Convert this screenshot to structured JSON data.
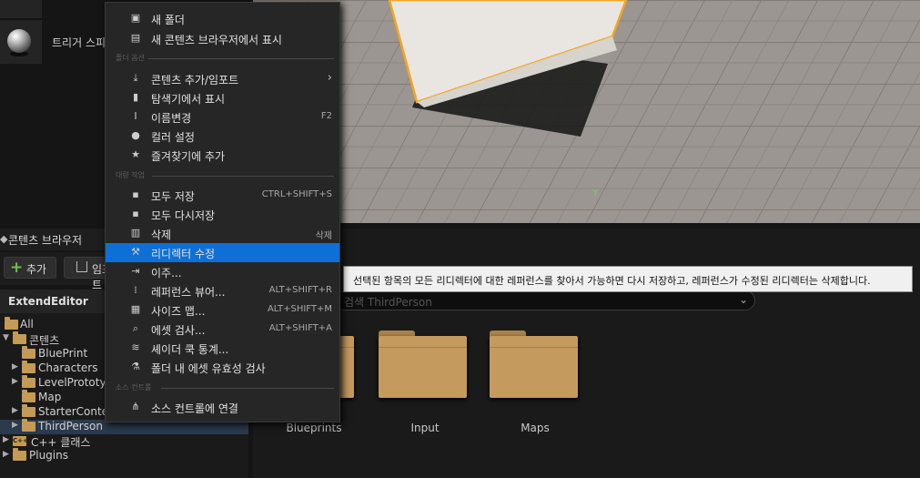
{
  "place_actors": {
    "items": [
      {
        "label": ""
      },
      {
        "label": "트리거 스피어"
      }
    ]
  },
  "viewport": {
    "axis_label": "Y"
  },
  "content_browser": {
    "tab_label": "콘텐츠 브라우저",
    "add_label": "추가",
    "import_label": "임포트",
    "tree_header": "ExtendEditor",
    "tree": [
      {
        "label": "All"
      },
      {
        "label": "콘텐츠"
      },
      {
        "label": "BluePrint"
      },
      {
        "label": "Characters"
      },
      {
        "label": "LevelPrototyping"
      },
      {
        "label": "Map"
      },
      {
        "label": "StarterContent"
      },
      {
        "label": "ThirdPerson"
      },
      {
        "label": "C++ 클래스"
      },
      {
        "label": "Plugins"
      }
    ],
    "search_placeholder": "검색 ThirdPerson",
    "folders": [
      {
        "label": "Blueprints"
      },
      {
        "label": "Input"
      },
      {
        "label": "Maps"
      }
    ]
  },
  "context_menu": {
    "items": [
      {
        "label": "새 폴더",
        "shortcut": "",
        "icon": "new-folder-icon"
      },
      {
        "label": "새 콘텐츠 브라우저에서 표시",
        "shortcut": "",
        "icon": "browse-icon"
      },
      {
        "label": "콘텐츠 추가/임포트",
        "shortcut": "",
        "icon": "import-icon"
      },
      {
        "label": "탐색기에서 표시",
        "shortcut": "",
        "icon": "explorer-icon"
      },
      {
        "label": "이름변경",
        "shortcut": "F2",
        "icon": "rename-icon"
      },
      {
        "label": "컬러 설정",
        "shortcut": "",
        "icon": "color-icon"
      },
      {
        "label": "즐겨찾기에 추가",
        "shortcut": "",
        "icon": "star-icon"
      },
      {
        "label": "모두 저장",
        "shortcut": "CTRL+SHIFT+S",
        "icon": "save-icon"
      },
      {
        "label": "모두 다시저장",
        "shortcut": "",
        "icon": "resave-icon"
      },
      {
        "label": "삭제",
        "shortcut": "삭제",
        "icon": "trash-icon"
      },
      {
        "label": "리디렉터 수정",
        "shortcut": "",
        "icon": "wrench-icon"
      },
      {
        "label": "이주...",
        "shortcut": "",
        "icon": "migrate-icon"
      },
      {
        "label": "레퍼런스 뷰어...",
        "shortcut": "ALT+SHIFT+R",
        "icon": "reference-icon"
      },
      {
        "label": "사이즈 맵...",
        "shortcut": "ALT+SHIFT+M",
        "icon": "sizemap-icon"
      },
      {
        "label": "에셋 검사...",
        "shortcut": "ALT+SHIFT+A",
        "icon": "audit-icon"
      },
      {
        "label": "셰이더 쿡 통계...",
        "shortcut": "",
        "icon": "shader-icon"
      },
      {
        "label": "폴더 내 에셋 유효성 검사",
        "shortcut": "",
        "icon": "flask-icon"
      },
      {
        "label": "소스 컨트롤에 연결",
        "shortcut": "",
        "icon": "source-control-icon"
      }
    ],
    "sections": [
      {
        "label": "폴더 옵션"
      },
      {
        "label": "대량 작업"
      },
      {
        "label": "소스 컨트롤"
      }
    ]
  },
  "tooltip": {
    "text": "선택된 항목의 모든 리디렉터에 대한 레퍼런스를 찾아서 가능하면 다시 저장하고, 레퍼런스가 수정된 리디렉터는 삭제합니다."
  },
  "colors": {
    "highlight": "#0e70d6",
    "folder": "#c49a5e",
    "selection_outline": "#f5a623"
  }
}
